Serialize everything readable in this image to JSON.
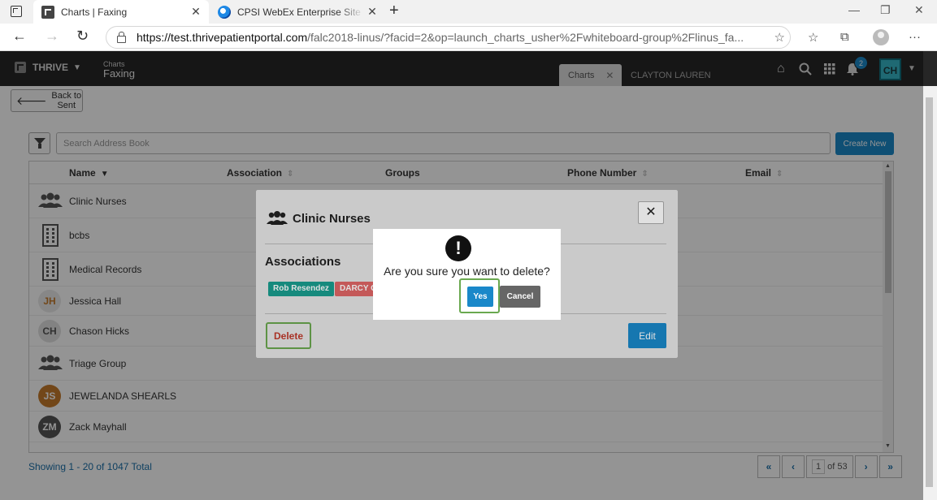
{
  "browser": {
    "tabs": [
      {
        "title": "Charts | Faxing"
      },
      {
        "title": "CPSI WebEx Enterprise Site - Rep"
      }
    ],
    "url_host": "https://test.thrivepatientportal.com",
    "url_rest": "/falc2018-linus/?facid=2&op=launch_charts_usher%2Fwhiteboard-group%2Flinus_fa..."
  },
  "header": {
    "brand": "THRIVE",
    "crumb_small": "Charts",
    "crumb_big": "Faxing",
    "tabs": [
      {
        "label": "Charts"
      },
      {
        "label": "CLAYTON LAUREN"
      }
    ],
    "notification_count": "2",
    "user_initials": "CH"
  },
  "page": {
    "back_label": "Back to Sent",
    "search_placeholder": "Search Address Book",
    "create_label": "Create New",
    "columns": [
      {
        "label": "Name"
      },
      {
        "label": "Association"
      },
      {
        "label": "Groups"
      },
      {
        "label": "Phone Number"
      },
      {
        "label": "Email"
      }
    ],
    "rows": [
      {
        "name": "Clinic Nurses",
        "type": "group"
      },
      {
        "name": "bcbs",
        "type": "building"
      },
      {
        "name": "Medical Records",
        "type": "building"
      },
      {
        "name": "Jessica Hall",
        "type": "avatar",
        "initials": "JH",
        "bg": "#e8e8e8",
        "fg": "#c47a2c"
      },
      {
        "name": "Chason Hicks",
        "type": "avatar",
        "initials": "CH",
        "bg": "#e0e0e0",
        "fg": "#555555"
      },
      {
        "name": "Triage Group",
        "type": "group"
      },
      {
        "name": "JEWELANDA SHEARLS",
        "type": "avatar",
        "initials": "JS",
        "bg": "#c47a2c",
        "fg": "#ffffff"
      },
      {
        "name": "Zack Mayhall",
        "type": "avatar",
        "initials": "ZM",
        "bg": "#555555",
        "fg": "#ffffff"
      }
    ],
    "total_label": "Showing 1 - 20 of 1047 Total",
    "pager": {
      "current": "1",
      "of_label": "of 53"
    }
  },
  "modal": {
    "title": "Clinic Nurses",
    "associations_heading": "Associations",
    "tags": [
      {
        "label": "Rob Resendez",
        "color": "#1a9e8f"
      },
      {
        "label": "DARCY G",
        "color": "#e06666"
      }
    ],
    "delete_label": "Delete",
    "edit_label": "Edit"
  },
  "confirm": {
    "message": "Are you sure you want to delete?",
    "yes_label": "Yes",
    "cancel_label": "Cancel"
  },
  "colors": {
    "accent": "#1a88c9",
    "highlight_outline": "#6aa84f"
  }
}
